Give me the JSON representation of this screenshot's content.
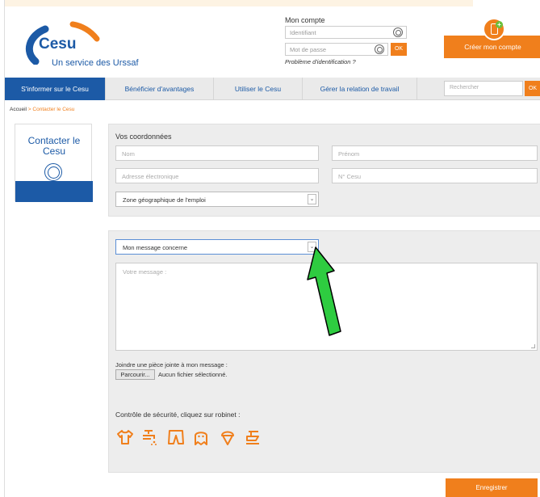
{
  "header": {
    "logo_name": "Cesu",
    "logo_sub": "Un service des Urssaf",
    "account_title": "Mon compte",
    "login_placeholder": "Identifiant",
    "password_placeholder": "Mot de passe",
    "ok_label": "OK",
    "problem_link": "Problème d'identification ?",
    "create_account_label": "Créer mon compte"
  },
  "nav": {
    "items": [
      {
        "label": "S'informer sur le Cesu"
      },
      {
        "label": "Bénéficier d'avantages"
      },
      {
        "label": "Utiliser le Cesu"
      },
      {
        "label": "Gérer la relation de travail"
      }
    ],
    "search_placeholder": "Rechercher",
    "search_ok": "OK"
  },
  "breadcrumb": {
    "home": "Accueil",
    "separator": ">",
    "current": "Contacter le Cesu"
  },
  "card": {
    "title": "Contacter le Cesu"
  },
  "coords": {
    "title": "Vos coordonnées",
    "nom_placeholder": "Nom",
    "prenom_placeholder": "Prénom",
    "email_placeholder": "Adresse électronique",
    "cesu_placeholder": "N° Cesu",
    "zone_select": "Zone géographique de l'emploi"
  },
  "message": {
    "concern_select": "Mon message concerne",
    "message_placeholder": "Votre message :",
    "attach_label": "Joindre une pièce jointe à mon message :",
    "browse_label": "Parcourir...",
    "no_file": "Aucun fichier sélectionné."
  },
  "security": {
    "label": "Contrôle de sécurité, cliquez sur robinet :",
    "icons": [
      "tshirt-icon",
      "faucet-icon",
      "shorts-icon",
      "ghost-icon",
      "icecream-icon",
      "boat-icon"
    ]
  },
  "save_label": "Enregistrer",
  "colors": {
    "brand_blue": "#1c5aa6",
    "accent_orange": "#f07f1c",
    "arrow_green": "#2ecc40"
  }
}
